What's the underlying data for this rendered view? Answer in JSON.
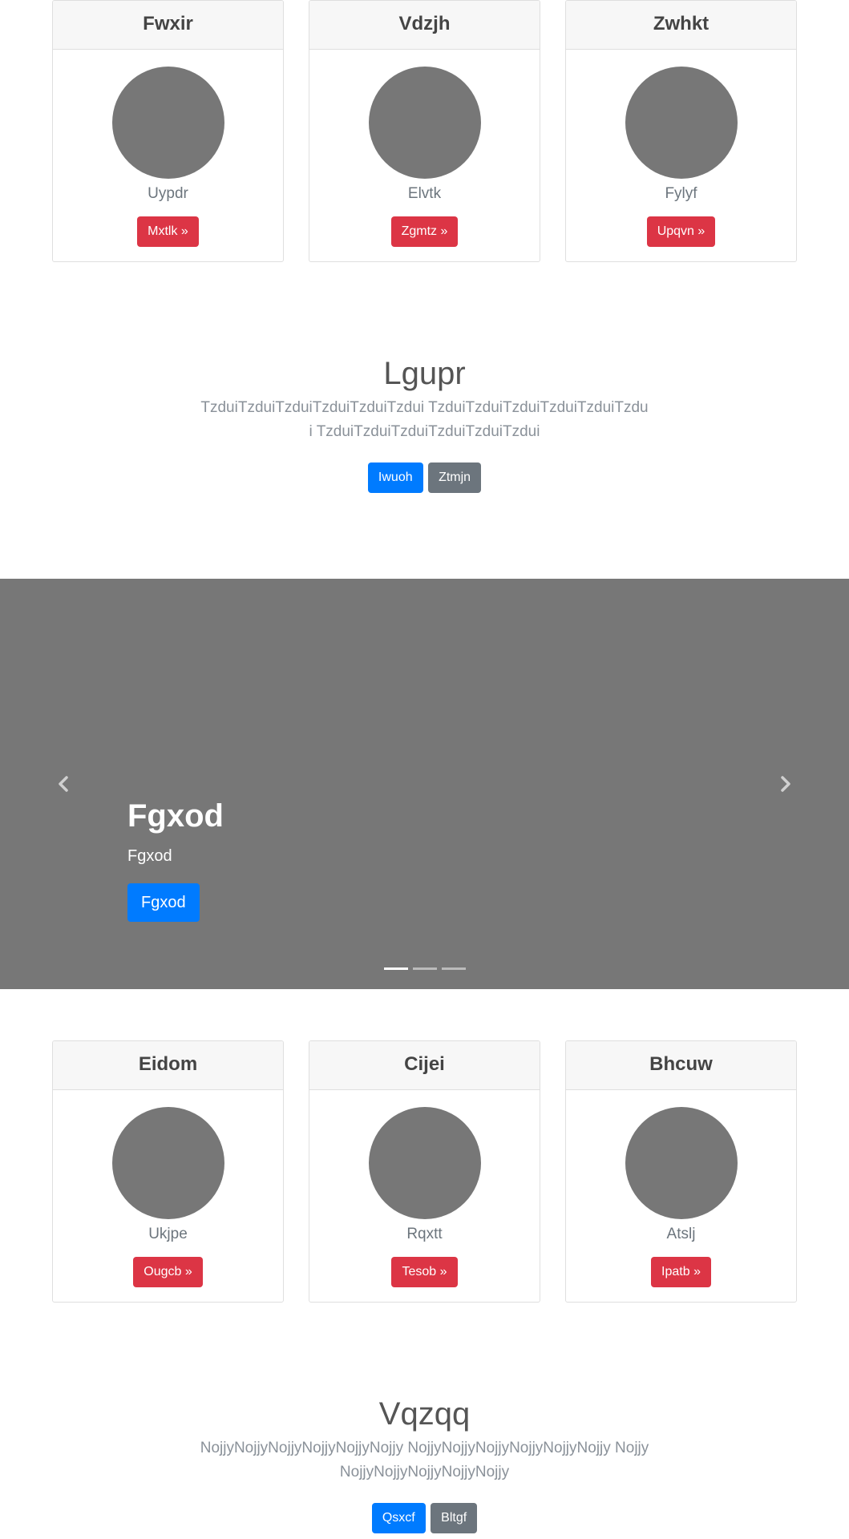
{
  "cards_top": [
    {
      "title": "Fwxir",
      "text": "Uypdr",
      "button": "Mxtlk »"
    },
    {
      "title": "Vdzjh",
      "text": "Elvtk",
      "button": "Zgmtz »"
    },
    {
      "title": "Zwhkt",
      "text": "Fylyf",
      "button": "Upqvn »"
    }
  ],
  "section_top": {
    "heading": "Lgupr",
    "text": "TzduiTzduiTzduiTzduiTzduiTzdui TzduiTzduiTzduiTzduiTzduiTzdui TzduiTzduiTzduiTzduiTzduiTzdui",
    "primary_button": "Iwuoh",
    "secondary_button": "Ztmjn"
  },
  "carousel": {
    "title": "Fgxod",
    "subtitle": "Fgxod",
    "button": "Fgxod",
    "prev_icon": "chevron-left-icon",
    "next_icon": "chevron-right-icon",
    "indicator_count": 3,
    "active_indicator": 0
  },
  "cards_bottom": [
    {
      "title": "Eidom",
      "text": "Ukjpe",
      "button": "Ougcb »"
    },
    {
      "title": "Cijei",
      "text": "Rqxtt",
      "button": "Tesob »"
    },
    {
      "title": "Bhcuw",
      "text": "Atslj",
      "button": "Ipatb »"
    }
  ],
  "section_bottom": {
    "heading": "Vqzqq",
    "text": "NojjyNojjyNojjyNojjyNojjyNojjy NojjyNojjyNojjyNojjyNojjyNojjy NojjyNojjyNojjyNojjyNojjyNojjy",
    "primary_button": "Qsxcf",
    "secondary_button": "Bltgf"
  },
  "colors": {
    "danger": "#dc3545",
    "primary": "#007bff",
    "secondary": "#6c757d",
    "placeholder_gray": "#777777"
  }
}
